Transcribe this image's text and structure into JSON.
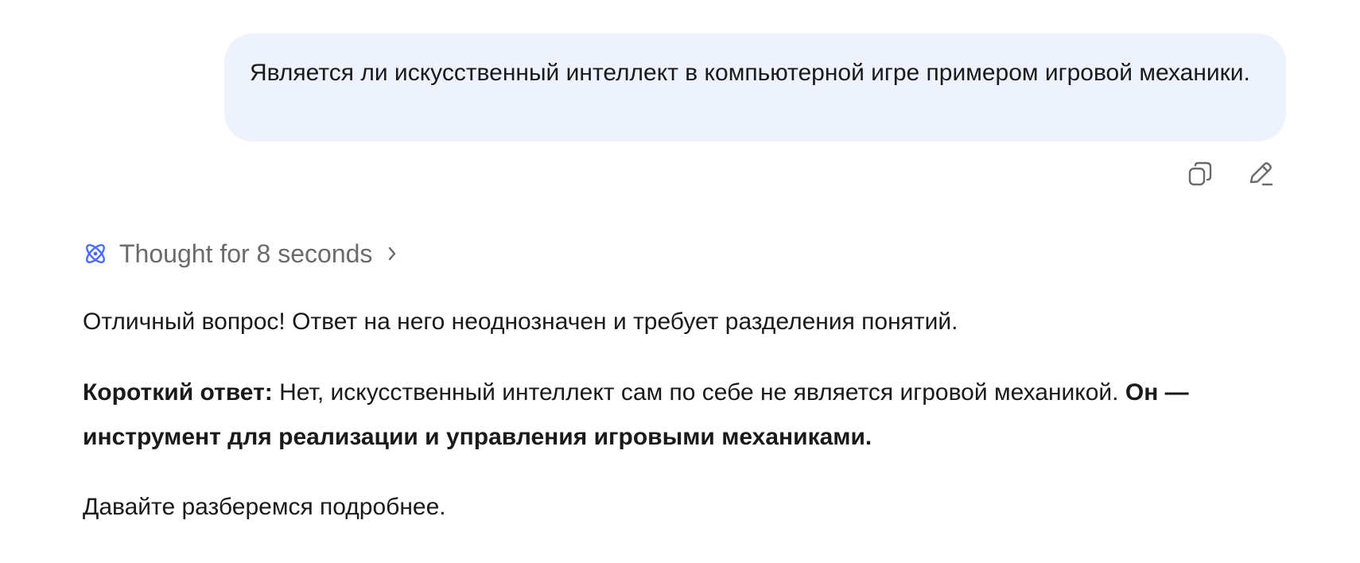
{
  "user_message": {
    "text": "Является ли искусственный интеллект в компьютерной игре примером игровой механики."
  },
  "message_actions": {
    "copy_icon": "copy-icon",
    "edit_icon": "edit-icon"
  },
  "thought": {
    "icon": "atom-icon",
    "label": "Thought for 8 seconds",
    "chevron": "chevron-right-icon",
    "accent_color": "#4a6cf7"
  },
  "answer": {
    "paragraph_1": "Отличный вопрос! Ответ на него неоднозначен и требует разделения понятий.",
    "paragraph_2": {
      "bold_lead": "Короткий ответ:",
      "body": " Нет, искусственный интеллект сам по себе не является игровой механикой. ",
      "bold_tail": "Он — инструмент для реализации и управления игровыми механиками."
    },
    "paragraph_3": "Давайте разберемся подробнее."
  }
}
